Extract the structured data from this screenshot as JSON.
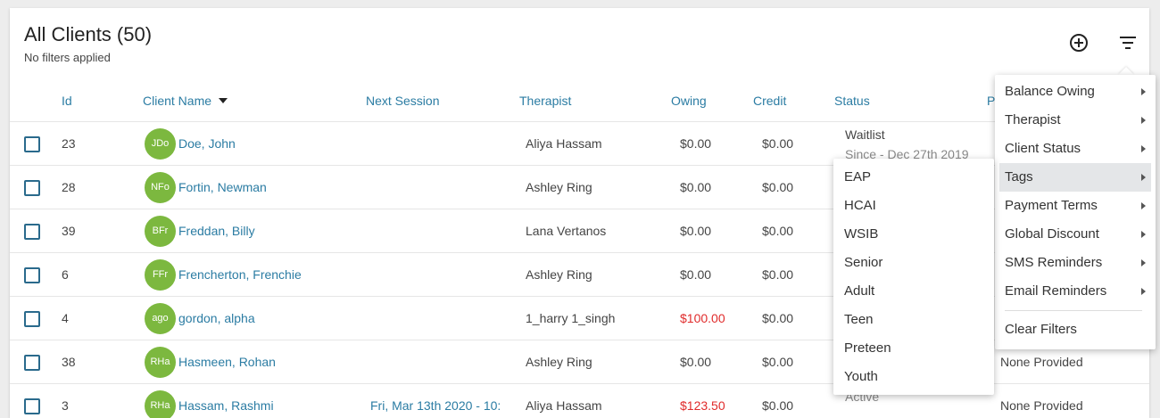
{
  "header": {
    "title": "All Clients (50)",
    "subtitle": "No filters applied",
    "add_icon": "plus-circle-icon",
    "filter_icon": "filter-icon"
  },
  "columns": {
    "id": "Id",
    "client_name": "Client Name",
    "next_session": "Next Session",
    "therapist": "Therapist",
    "owing": "Owing",
    "credit": "Credit",
    "status": "Status",
    "extra": "P"
  },
  "rows": [
    {
      "id": "23",
      "initials": "JDo",
      "name": "Doe, John",
      "next_session": "",
      "therapist": "Aliya Hassam",
      "owing": "$0.00",
      "owing_red": false,
      "credit": "$0.00",
      "status": "Waitlist",
      "status_detail": "Since - Dec 27th 2019",
      "extra": ""
    },
    {
      "id": "28",
      "initials": "NFo",
      "name": "Fortin, Newman",
      "next_session": "",
      "therapist": "Ashley Ring",
      "owing": "$0.00",
      "owing_red": false,
      "credit": "$0.00",
      "status": "",
      "status_detail": "",
      "extra": ""
    },
    {
      "id": "39",
      "initials": "BFr",
      "name": "Freddan, Billy",
      "next_session": "",
      "therapist": "Lana Vertanos",
      "owing": "$0.00",
      "owing_red": false,
      "credit": "$0.00",
      "status": "",
      "status_detail": "",
      "extra": ""
    },
    {
      "id": "6",
      "initials": "FFr",
      "name": "Frencherton, Frenchie",
      "next_session": "",
      "therapist": "Ashley Ring",
      "owing": "$0.00",
      "owing_red": false,
      "credit": "$0.00",
      "status": "",
      "status_detail": "",
      "extra": ""
    },
    {
      "id": "4",
      "initials": "ago",
      "name": "gordon, alpha",
      "next_session": "",
      "therapist": "1_harry 1_singh",
      "owing": "$100.00",
      "owing_red": true,
      "credit": "$0.00",
      "status": "",
      "status_detail": "",
      "extra": ""
    },
    {
      "id": "38",
      "initials": "RHa",
      "name": "Hasmeen, Rohan",
      "next_session": "",
      "therapist": "Ashley Ring",
      "owing": "$0.00",
      "owing_red": false,
      "credit": "$0.00",
      "status": "",
      "status_detail": "",
      "extra": "None Provided"
    },
    {
      "id": "3",
      "initials": "RHa",
      "name": "Hassam, Rashmi",
      "next_session": "Fri, Mar 13th 2020 - 10:",
      "therapist": "Aliya Hassam",
      "owing": "$123.50",
      "owing_red": true,
      "credit": "$0.00",
      "status": "Active",
      "status_detail": "",
      "extra": "None Provided"
    }
  ],
  "filter_menu": {
    "items": [
      {
        "label": "Balance Owing",
        "has_submenu": true
      },
      {
        "label": "Therapist",
        "has_submenu": true
      },
      {
        "label": "Client Status",
        "has_submenu": true
      },
      {
        "label": "Tags",
        "has_submenu": true,
        "active": true
      },
      {
        "label": "Payment Terms",
        "has_submenu": true
      },
      {
        "label": "Global Discount",
        "has_submenu": true
      },
      {
        "label": "SMS Reminders",
        "has_submenu": true
      },
      {
        "label": "Email Reminders",
        "has_submenu": true
      }
    ],
    "clear_label": "Clear Filters"
  },
  "tags_submenu": {
    "items": [
      "EAP",
      "HCAI",
      "WSIB",
      "Senior",
      "Adult",
      "Teen",
      "Preteen",
      "Youth"
    ]
  },
  "colors": {
    "accent": "#2b7ca3",
    "avatar": "#7cb83f",
    "owing_red": "#e02b2b",
    "checkbox": "#2a6a8c"
  }
}
